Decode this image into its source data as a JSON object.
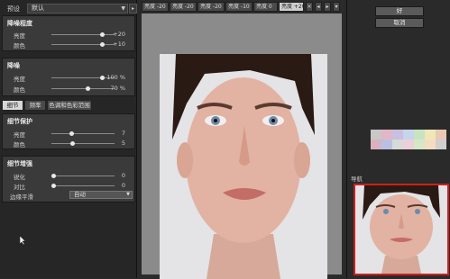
{
  "left": {
    "preset_label": "预设",
    "preset_value": "默认",
    "menu_icon": "menu-arrow",
    "sections": [
      {
        "title": "降噪程度",
        "rows": [
          {
            "label": "亮度",
            "value": "+20",
            "pos": 0.9
          },
          {
            "label": "颜色",
            "value": "+10",
            "pos": 0.7
          }
        ]
      },
      {
        "title": "降噪",
        "rows": [
          {
            "label": "亮度",
            "value": "100  %",
            "pos": 0.9
          },
          {
            "label": "颜色",
            "value": "70  %",
            "pos": 0.63
          }
        ]
      }
    ],
    "tabs": [
      "细节",
      "频率",
      "色调和色彩范围"
    ],
    "detail_protect": {
      "title": "细节保护",
      "rows": [
        {
          "label": "亮度",
          "value": "7",
          "pos": 0.32
        },
        {
          "label": "颜色",
          "value": "5",
          "pos": 0.33
        }
      ]
    },
    "detail_enhance": {
      "title": "细节增强",
      "rows": [
        {
          "label": "锐化",
          "value": "0",
          "pos": 0.0
        },
        {
          "label": "对比",
          "value": "0",
          "pos": 0.0
        }
      ],
      "edge_label": "边缘平滑",
      "edge_value": "自动"
    }
  },
  "center": {
    "tabs": [
      "亮度 -20",
      "亮度 -20",
      "亮度 -20",
      "亮度 -10",
      "亮度 0",
      "亮度 +20"
    ],
    "close_icon": "×"
  },
  "right": {
    "ok_label": "好",
    "cancel_label": "取消",
    "navigator_label": "导航",
    "swatch_colors": [
      "#c8c8c8",
      "#e2b6c6",
      "#c9bfe0",
      "#c6d4ec",
      "#c7e3c0",
      "#f0e6b8",
      "#e9c9b5",
      "#d9b2c0",
      "#b8c1e3",
      "#d9d9d9",
      "#ecd0d8",
      "#d6e6c8",
      "#f3dcc0",
      "#cfcfcf"
    ]
  },
  "colors": {
    "accent": "#cc1f1f"
  }
}
